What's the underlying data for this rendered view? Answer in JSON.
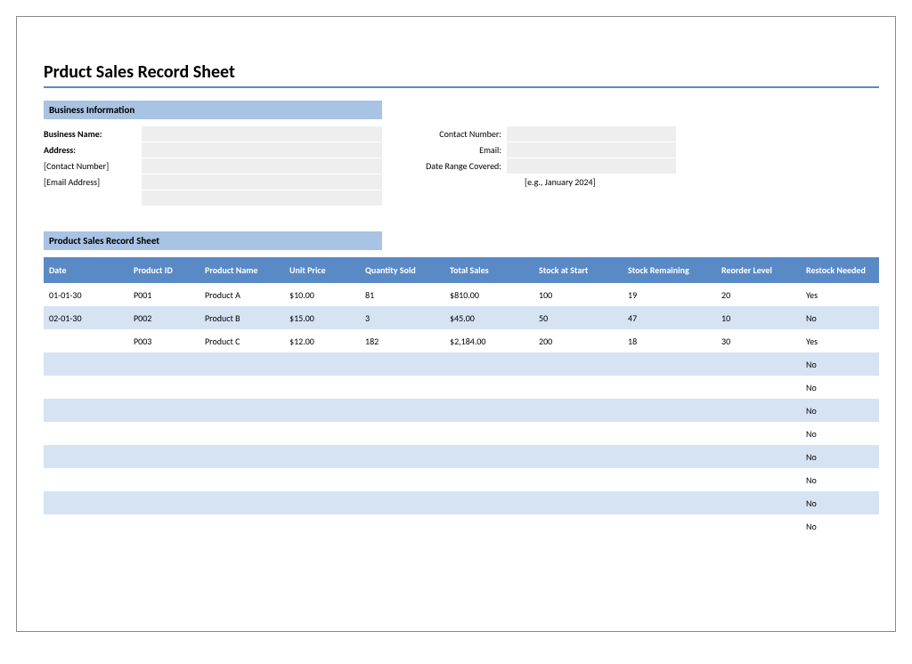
{
  "title": "Prduct Sales Record Sheet",
  "sections": {
    "business_info": "Business Information",
    "sales_sheet": "Product Sales Record Sheet"
  },
  "biz_left_labels": {
    "name": "Business Name:",
    "address": "Address:",
    "contact_ph": "[Contact Number]",
    "email_ph": "[Email Address]"
  },
  "biz_right_labels": {
    "contact": "Contact Number:",
    "email": "Email:",
    "range": "Date Range Covered:",
    "example": "[e.g., January 2024]"
  },
  "columns": {
    "date": "Date",
    "pid": "Product ID",
    "pname": "Product Name",
    "price": "Unit Price",
    "qty": "Quantity Sold",
    "total": "Total Sales",
    "start": "Stock at Start",
    "remain": "Stock Remaining",
    "reorder": "Reorder Level",
    "need": "Restock Needed"
  },
  "rows": [
    {
      "date": "01-01-30",
      "pid": "P001",
      "pname": "Product A",
      "price": "$10.00",
      "qty": "81",
      "total": "$810.00",
      "start": "100",
      "remain": "19",
      "reorder": "20",
      "need": "Yes",
      "need_red": true
    },
    {
      "date": "02-01-30",
      "pid": "P002",
      "pname": "Product B",
      "price": "$15.00",
      "qty": "3",
      "total": "$45.00",
      "start": "50",
      "remain": "47",
      "reorder": "10",
      "need": "No",
      "need_red": false
    },
    {
      "date": "",
      "pid": "P003",
      "pname": "Product C",
      "price": "$12.00",
      "qty": "182",
      "total": "$2,184.00",
      "start": "200",
      "remain": "18",
      "reorder": "30",
      "need": "Yes",
      "need_red": true
    },
    {
      "date": "",
      "pid": "",
      "pname": "",
      "price": "",
      "qty": "",
      "total": "",
      "start": "",
      "remain": "",
      "reorder": "",
      "need": "No",
      "need_red": false
    },
    {
      "date": "",
      "pid": "",
      "pname": "",
      "price": "",
      "qty": "",
      "total": "",
      "start": "",
      "remain": "",
      "reorder": "",
      "need": "No",
      "need_red": false
    },
    {
      "date": "",
      "pid": "",
      "pname": "",
      "price": "",
      "qty": "",
      "total": "",
      "start": "",
      "remain": "",
      "reorder": "",
      "need": "No",
      "need_red": false
    },
    {
      "date": "",
      "pid": "",
      "pname": "",
      "price": "",
      "qty": "",
      "total": "",
      "start": "",
      "remain": "",
      "reorder": "",
      "need": "No",
      "need_red": false
    },
    {
      "date": "",
      "pid": "",
      "pname": "",
      "price": "",
      "qty": "",
      "total": "",
      "start": "",
      "remain": "",
      "reorder": "",
      "need": "No",
      "need_red": false
    },
    {
      "date": "",
      "pid": "",
      "pname": "",
      "price": "",
      "qty": "",
      "total": "",
      "start": "",
      "remain": "",
      "reorder": "",
      "need": "No",
      "need_red": false
    },
    {
      "date": "",
      "pid": "",
      "pname": "",
      "price": "",
      "qty": "",
      "total": "",
      "start": "",
      "remain": "",
      "reorder": "",
      "need": "No",
      "need_red": false
    },
    {
      "date": "",
      "pid": "",
      "pname": "",
      "price": "",
      "qty": "",
      "total": "",
      "start": "",
      "remain": "",
      "reorder": "",
      "need": "No",
      "need_red": false
    }
  ],
  "chart_data": {
    "type": "table",
    "columns": [
      "Date",
      "Product ID",
      "Product Name",
      "Unit Price",
      "Quantity Sold",
      "Total Sales",
      "Stock at Start",
      "Stock Remaining",
      "Reorder Level",
      "Restock Needed"
    ],
    "rows": [
      [
        "01-01-30",
        "P001",
        "Product A",
        10.0,
        81,
        810.0,
        100,
        19,
        20,
        "Yes"
      ],
      [
        "02-01-30",
        "P002",
        "Product B",
        15.0,
        3,
        45.0,
        50,
        47,
        10,
        "No"
      ],
      [
        "",
        "P003",
        "Product C",
        12.0,
        182,
        2184.0,
        200,
        18,
        30,
        "Yes"
      ]
    ]
  }
}
